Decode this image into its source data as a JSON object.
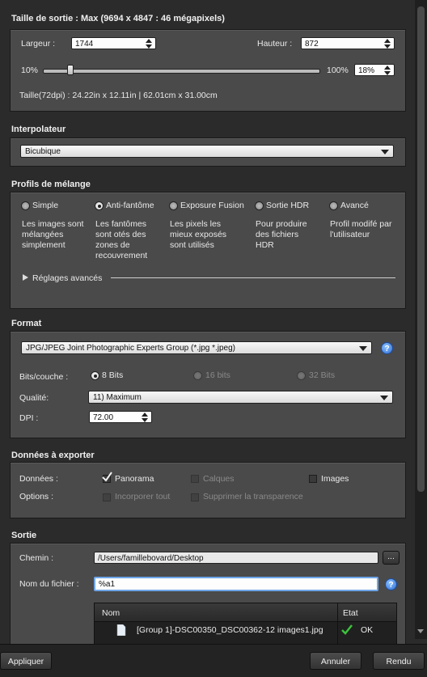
{
  "output_size": {
    "title": "Taille de sortie : Max (9694 x 4847 : 46 mégapixels)",
    "width_label": "Largeur :",
    "width_value": "1744",
    "height_label": "Hauteur :",
    "height_value": "872",
    "scale_min": "10%",
    "scale_max": "100%",
    "scale_value": "18%",
    "scale_percent": 18,
    "size_info": "Taille(72dpi) : 24.22in x 12.11in | 62.01cm x 31.00cm"
  },
  "interpolator": {
    "title": "Interpolateur",
    "value": "Bicubique"
  },
  "blend_profiles": {
    "title": "Profils de mélange",
    "selected": "Anti-fantôme",
    "options": [
      {
        "label": "Simple",
        "desc": "Les images sont mélangées simplement"
      },
      {
        "label": "Anti-fantôme",
        "desc": "Les fantômes sont otés des zones de recouvrement"
      },
      {
        "label": "Exposure Fusion",
        "desc": "Les pixels les mieux exposés sont utilisés"
      },
      {
        "label": "Sortie HDR",
        "desc": "Pour produire des fichiers HDR"
      },
      {
        "label": "Avancé",
        "desc": "Profil modifé par l'utilisateur"
      }
    ],
    "advanced": "Réglages avancés"
  },
  "format": {
    "title": "Format",
    "type": "JPG/JPEG Joint Photographic Experts Group (*.jpg *.jpeg)",
    "bits_label": "Bits/couche :",
    "bits_options": [
      "8 Bits",
      "16 bits",
      "32 Bits"
    ],
    "quality_label": "Qualité:",
    "quality_value": "11) Maximum",
    "dpi_label": "DPI :",
    "dpi_value": "72.00"
  },
  "export": {
    "title": "Données à exporter",
    "data_label": "Données :",
    "options_label": "Options :",
    "panorama": "Panorama",
    "calques": "Calques",
    "images": "Images",
    "incorporer": "Incorporer tout",
    "supprimer": "Supprimer la transparence"
  },
  "output": {
    "title": "Sortie",
    "path_label": "Chemin :",
    "path_value": "/Users/famillebovard/Desktop",
    "browse": "...",
    "filename_label": "Nom du fichier :",
    "filename_value": "%a1",
    "col_name": "Nom",
    "col_state": "Etat",
    "row_name": "[Group 1]-DSC00350_DSC00362-12 images1.jpg",
    "row_state": "OK"
  },
  "footer": {
    "apply": "Appliquer",
    "cancel": "Annuler",
    "render": "Rendu"
  },
  "help_symbol": "?",
  "colors": {
    "background": "#2b2b2b",
    "panel": "#4a4a4a",
    "accent_ok": "#3cc13c"
  }
}
